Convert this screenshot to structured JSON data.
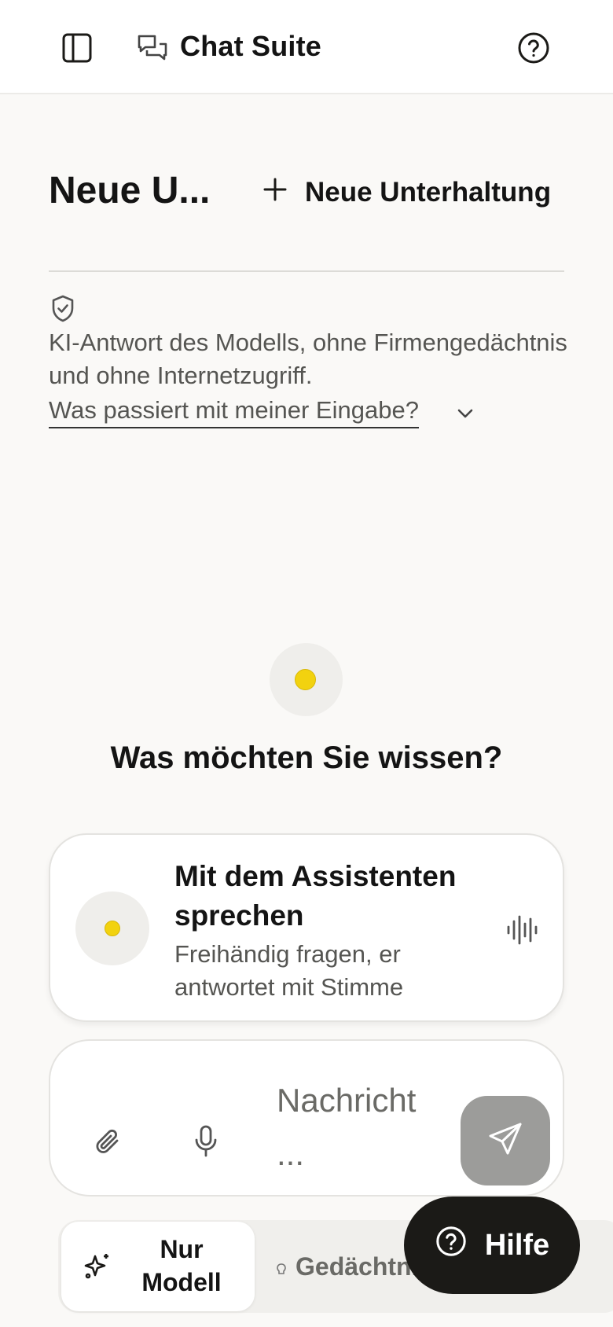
{
  "header": {
    "app_title": "Chat Suite",
    "icons": {
      "sidebar": "sidebar-toggle-icon",
      "app": "chat-bubbles-icon",
      "help": "help-circle-icon"
    }
  },
  "conversation": {
    "title": "Neue U...",
    "new_button_label": "Neue Unterhaltung"
  },
  "notice": {
    "text": "KI-Antwort des Modells, ohne Firmengedächtnis und ohne Internetzugriff.",
    "link_label": "Was passiert mit meiner Eingabe?"
  },
  "empty_state": {
    "question": "Was möchten Sie wissen?"
  },
  "assistant_card": {
    "title": "Mit dem Assistenten sprechen",
    "subtitle": "Freihändig fragen, er antwortet mit Stimme"
  },
  "composer": {
    "placeholder": "Nachricht ..."
  },
  "mode": {
    "active_label": "Nur Modell",
    "other_label": "Gedächtnis aktiviert"
  },
  "help_button": {
    "label": "Hilfe"
  },
  "colors": {
    "accent_yellow": "#f2d20f",
    "dark": "#1b1a17",
    "background": "#faf9f7",
    "send_disabled": "#9c9c9a"
  }
}
